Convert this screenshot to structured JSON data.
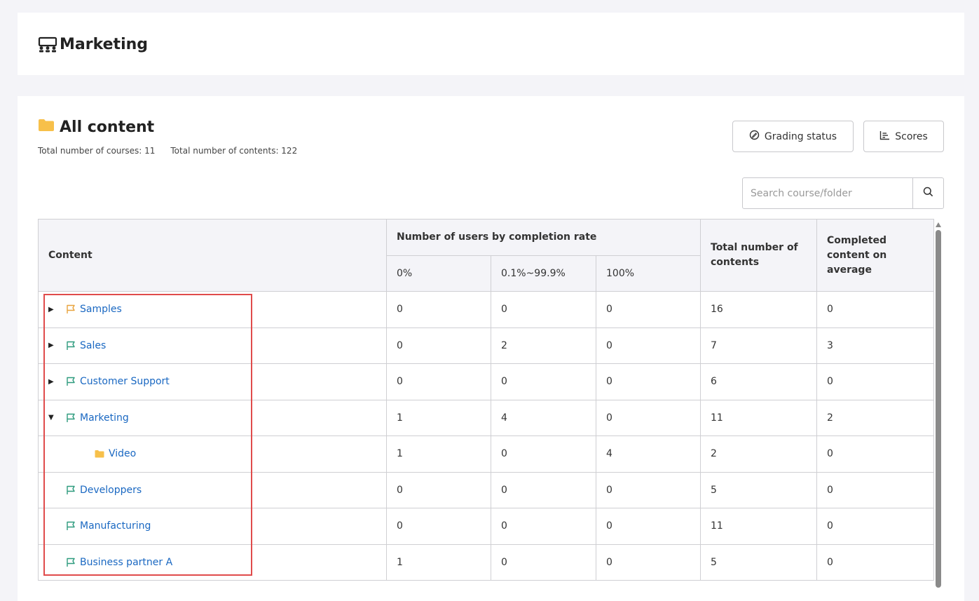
{
  "header": {
    "title": "Marketing",
    "icon": "group-icon"
  },
  "section": {
    "title": "All content",
    "icon": "folder-icon",
    "courses_label": "Total number of courses: 11",
    "contents_label": "Total number of contents: 122"
  },
  "toolbar": {
    "grading_label": "Grading status",
    "scores_label": "Scores"
  },
  "search": {
    "placeholder": "Search course/folder",
    "value": ""
  },
  "table": {
    "headers": {
      "content": "Content",
      "group": "Number of users by completion rate",
      "p0": "0%",
      "partial": "0.1%~99.9%",
      "p100": "100%",
      "total": "Total number of contents",
      "avg": "Completed content on average"
    },
    "rows": [
      {
        "name": "Samples",
        "expander": "collapsed",
        "icon": "flag-icon",
        "icon_color": "#e8a33d",
        "p0": "0",
        "partial": "0",
        "p100": "0",
        "total": "16",
        "avg": "0"
      },
      {
        "name": "Sales",
        "expander": "collapsed",
        "icon": "flag-icon",
        "icon_color": "#2e9b7e",
        "p0": "0",
        "partial": "2",
        "p100": "0",
        "total": "7",
        "avg": "3"
      },
      {
        "name": "Customer Support",
        "expander": "collapsed",
        "icon": "flag-icon",
        "icon_color": "#2e9b7e",
        "p0": "0",
        "partial": "0",
        "p100": "0",
        "total": "6",
        "avg": "0"
      },
      {
        "name": "Marketing",
        "expander": "expanded",
        "icon": "flag-icon",
        "icon_color": "#2e9b7e",
        "p0": "1",
        "partial": "4",
        "p100": "0",
        "total": "11",
        "avg": "2"
      },
      {
        "name": "Video",
        "expander": "none",
        "icon": "folder-icon",
        "icon_color": "#f7c04a",
        "p0": "1",
        "partial": "0",
        "p100": "4",
        "total": "2",
        "avg": "0"
      },
      {
        "name": "Developpers",
        "expander": "none",
        "icon": "flag-icon",
        "icon_color": "#2e9b7e",
        "p0": "0",
        "partial": "0",
        "p100": "0",
        "total": "5",
        "avg": "0"
      },
      {
        "name": "Manufacturing",
        "expander": "none",
        "icon": "flag-icon",
        "icon_color": "#2e9b7e",
        "p0": "0",
        "partial": "0",
        "p100": "0",
        "total": "11",
        "avg": "0"
      },
      {
        "name": "Business partner A",
        "expander": "none",
        "icon": "flag-icon",
        "icon_color": "#2e9b7e",
        "p0": "1",
        "partial": "0",
        "p100": "0",
        "total": "5",
        "avg": "0"
      }
    ]
  },
  "colors": {
    "link": "#1a68c2",
    "highlight": "#e04b4b",
    "folder": "#f7c04a"
  }
}
